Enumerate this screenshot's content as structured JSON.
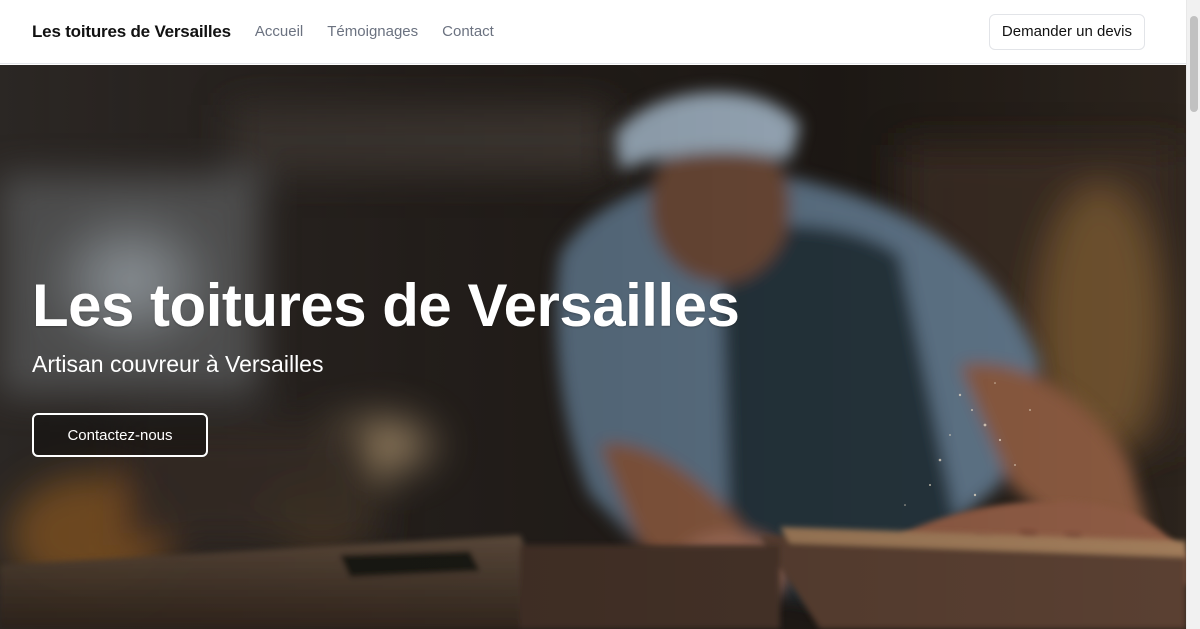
{
  "header": {
    "brand": "Les toitures de Versailles",
    "nav": [
      {
        "label": "Accueil"
      },
      {
        "label": "Témoignages"
      },
      {
        "label": "Contact"
      }
    ],
    "cta_label": "Demander un devis"
  },
  "hero": {
    "title": "Les toitures de Versailles",
    "subtitle": "Artisan couvreur à Versailles",
    "button_label": "Contactez-nous"
  },
  "colors": {
    "text_primary": "#111111",
    "nav_text": "#6b7280",
    "hero_text": "#ffffff"
  },
  "icons": {
    "hero_background": "carpenter-sanding-wood-photo"
  }
}
